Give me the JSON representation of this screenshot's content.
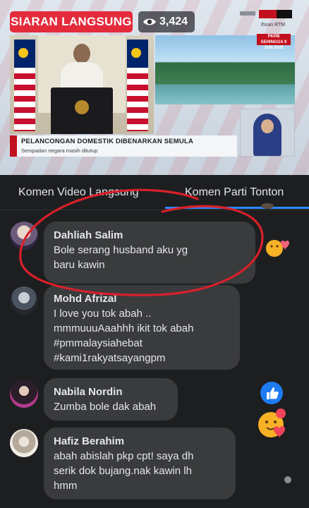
{
  "video": {
    "live_label": "SIARAN LANGSUNG",
    "viewer_count": "3,424",
    "viewer_icon": "eye-icon",
    "channel_logo_text": "BERITA RTM",
    "channel_sub": "Ihsan RTM",
    "date_tag": "PKPB SEHINGGA 9 JUN 2020",
    "caption_title": "PELANCONGAN DOMESTIK DIBENARKAN SEMULA",
    "caption_subtitle": "Sempadan negara masih ditutup"
  },
  "tabs": {
    "live_comments": "Komen Video Langsung",
    "party_comments": "Komen Parti Tonton"
  },
  "comments": [
    {
      "name": "Dahliah Salim",
      "text": "Bole serang husband aku yg\nbaru kawin",
      "reaction": "care-emoji-with-heart"
    },
    {
      "name": "Mohd Afrizal",
      "text": "I love you tok abah ..\nmmmuuuAaahhh ikit tok abah\n#pmmalaysiahebat\n#kami1rakyatsayangpm",
      "reaction": ""
    },
    {
      "name": "Nabila Nordin",
      "text": "Zumba bole dak abah",
      "reaction": "like-icon"
    },
    {
      "name": "Hafiz Berahim",
      "text": "abah abislah pkp cpt! saya dh\nserik dok bujang.nak kawin lh\nhmm",
      "reaction": "care-emoji"
    }
  ],
  "colors": {
    "live_red": "#e42b3c",
    "background": "#1d1e20",
    "bubble": "#3a3b3c",
    "accent_blue": "#2d88ff",
    "annotation_red": "#d8202a"
  }
}
